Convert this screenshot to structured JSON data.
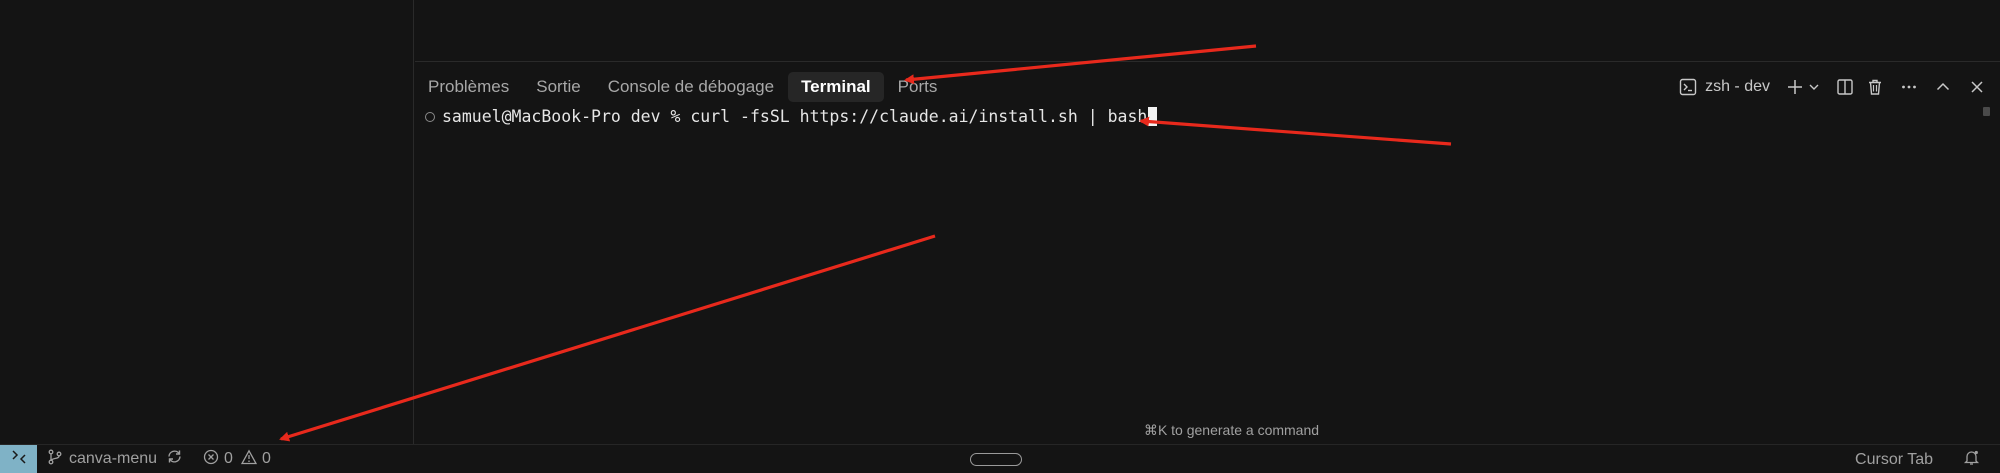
{
  "panel": {
    "tabs": [
      {
        "label": "Problèmes",
        "active": false
      },
      {
        "label": "Sortie",
        "active": false
      },
      {
        "label": "Console de débogage",
        "active": false
      },
      {
        "label": "Terminal",
        "active": true
      },
      {
        "label": "Ports",
        "active": false
      }
    ],
    "toolbar": {
      "terminal_name": "zsh - dev",
      "icons": [
        "terminal-icon",
        "plus-icon",
        "chevron-down-icon",
        "split-icon",
        "trash-icon",
        "more-icon",
        "chevron-up-icon",
        "close-icon"
      ]
    }
  },
  "terminal": {
    "prompt": "samuel@MacBook-Pro dev % ",
    "command": "curl -fsSL https://claude.ai/install.sh | bash"
  },
  "hint": "⌘K to generate a command",
  "statusbar": {
    "branch": "canva-menu",
    "errors": "0",
    "warnings": "0",
    "right_label": "Cursor Tab"
  },
  "colors": {
    "background": "#141414",
    "remote_accent": "#7fb2c6",
    "annotation_arrow": "#e8291c"
  }
}
